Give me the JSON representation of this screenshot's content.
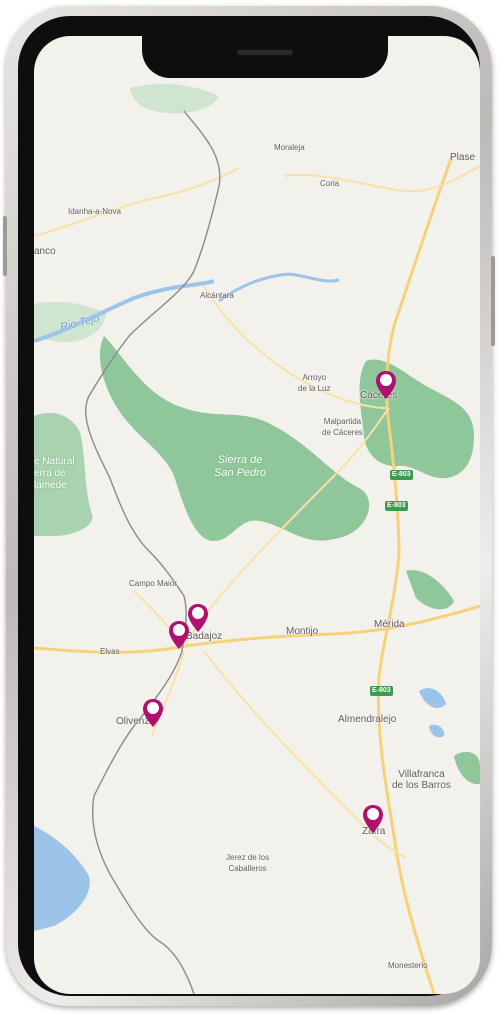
{
  "map": {
    "places": [
      {
        "id": "moraleja",
        "label": "Moraleja"
      },
      {
        "id": "coria",
        "label": "Coria"
      },
      {
        "id": "plasencia",
        "label": "Plase"
      },
      {
        "id": "idanha",
        "label": "Idanha-a-Nova"
      },
      {
        "id": "branco",
        "label": "anco"
      },
      {
        "id": "alcantara",
        "label": "Alcántara"
      },
      {
        "id": "arroyo",
        "label": "Arroyo\nde la Luz"
      },
      {
        "id": "caceres",
        "label": "Cáceres"
      },
      {
        "id": "malpartida",
        "label": "Malpartida\nde Cáceres"
      },
      {
        "id": "campomaior",
        "label": "Campo Maior"
      },
      {
        "id": "elvas",
        "label": "Elvas"
      },
      {
        "id": "badajoz",
        "label": "Badajoz"
      },
      {
        "id": "montijo",
        "label": "Montijo"
      },
      {
        "id": "merida",
        "label": "Mérida"
      },
      {
        "id": "almendralejo",
        "label": "Almendralejo"
      },
      {
        "id": "olivenza",
        "label": "Olivenza"
      },
      {
        "id": "villafranca",
        "label": "Villafranca\nde los Barros"
      },
      {
        "id": "zafra",
        "label": "Zafra"
      },
      {
        "id": "jerez",
        "label": "Jerez de los\nCaballeros"
      },
      {
        "id": "monesterio",
        "label": "Monesterio"
      }
    ],
    "parks": {
      "sierra_san_pedro": "Sierra de\nSan Pedro",
      "serra_mamede": "e Natural\nerra de\nlamede"
    },
    "river": "Rio Tejo",
    "highways": [
      "E-803",
      "E-803",
      "E-803"
    ],
    "markers": [
      "caceres",
      "badajoz-1",
      "badajoz-2",
      "olivenza",
      "zafra"
    ],
    "marker_color": "#b0116e",
    "park_color": "#8fc79a",
    "water_color": "#9cc4e8",
    "road_color": "#f7d17a"
  }
}
